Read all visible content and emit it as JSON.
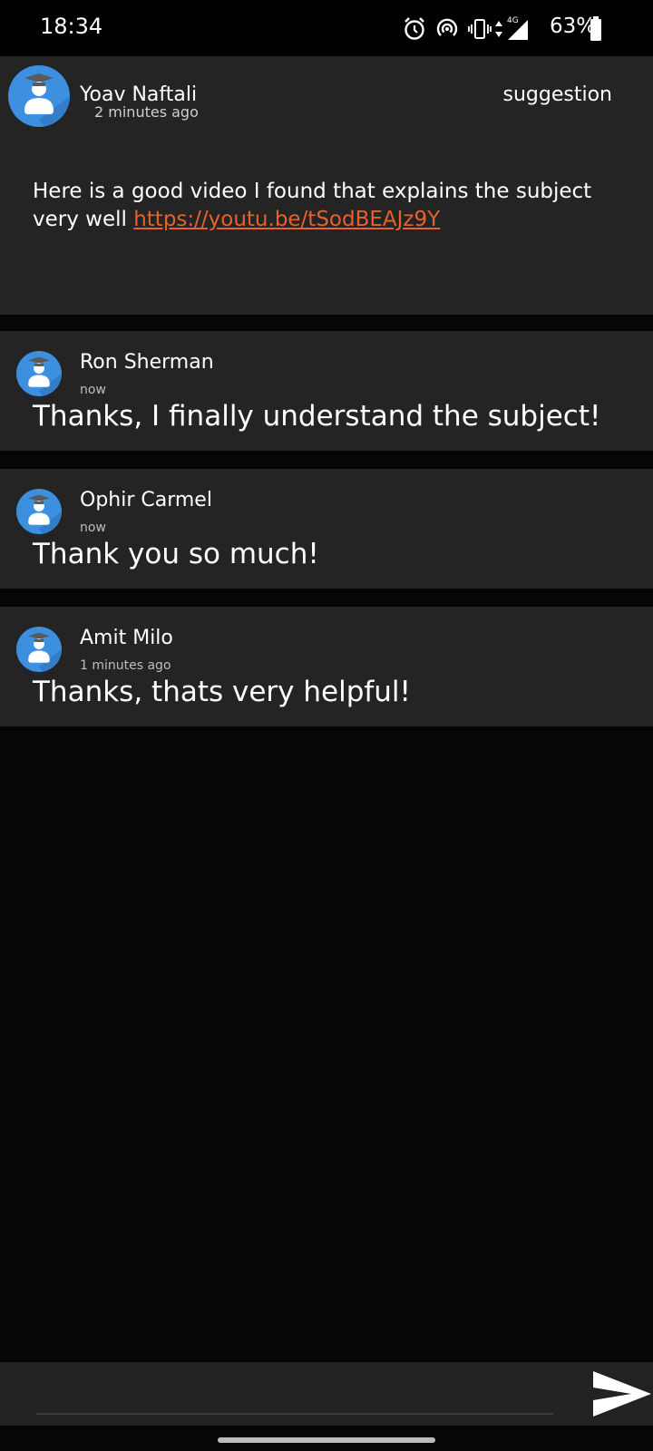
{
  "status_bar": {
    "time": "18:34",
    "battery_percent": "63%",
    "network": "4G",
    "icons": [
      "alarm-icon",
      "hotspot-icon",
      "vibrate-icon",
      "data-arrows-icon",
      "signal-icon",
      "battery-icon"
    ]
  },
  "post": {
    "author": "Yoav Naftali",
    "time": "2 minutes ago",
    "tag": "suggestion",
    "body_text": "Here is a good video I found that explains the subject very well ",
    "link": "https://youtu.be/tSodBEAJz9Y",
    "avatar_icon": "student-avatar-icon"
  },
  "comments": [
    {
      "author": "Ron Sherman",
      "time": "now",
      "text": "Thanks, I finally understand the subject!"
    },
    {
      "author": "Ophir Carmel",
      "time": "now",
      "text": "Thank you so much!"
    },
    {
      "author": "Amit Milo",
      "time": "1 minutes ago",
      "text": "Thanks, thats very helpful!"
    }
  ],
  "input": {
    "placeholder": "",
    "send_icon": "send-icon"
  },
  "colors": {
    "background": "#060606",
    "card": "#242424",
    "link": "#e8602c",
    "avatar_blue": "#3d8fe0"
  }
}
